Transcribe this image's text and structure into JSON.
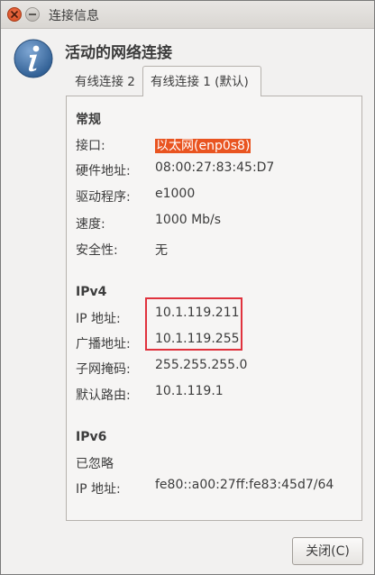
{
  "window": {
    "title": "连接信息"
  },
  "header": {
    "title": "活动的网络连接"
  },
  "tabs": [
    {
      "label": "有线连接 2",
      "active": false
    },
    {
      "label": "有线连接 1 (默认)",
      "active": true
    }
  ],
  "general": {
    "title": "常规",
    "rows": [
      {
        "label": "接口:",
        "value": "以太网(enp0s8)"
      },
      {
        "label": "硬件地址:",
        "value": "08:00:27:83:45:D7"
      },
      {
        "label": "驱动程序:",
        "value": "e1000"
      },
      {
        "label": "速度:",
        "value": "1000 Mb/s"
      },
      {
        "label": "安全性:",
        "value": "无"
      }
    ]
  },
  "ipv4": {
    "title": "IPv4",
    "rows": [
      {
        "label": "IP 地址:",
        "value": "10.1.119.211"
      },
      {
        "label": "广播地址:",
        "value": "10.1.119.255"
      },
      {
        "label": "子网掩码:",
        "value": "255.255.255.0"
      },
      {
        "label": "默认路由:",
        "value": "10.1.119.1"
      }
    ]
  },
  "ipv6": {
    "title": "IPv6",
    "ignored": "已忽略",
    "rows": [
      {
        "label": "IP 地址:",
        "value": "fe80::a00:27ff:fe83:45d7/64"
      }
    ]
  },
  "buttons": {
    "close_label": "关闭(C)"
  },
  "colors": {
    "accent": "#e95420",
    "highlight_box": "#e0323d"
  }
}
